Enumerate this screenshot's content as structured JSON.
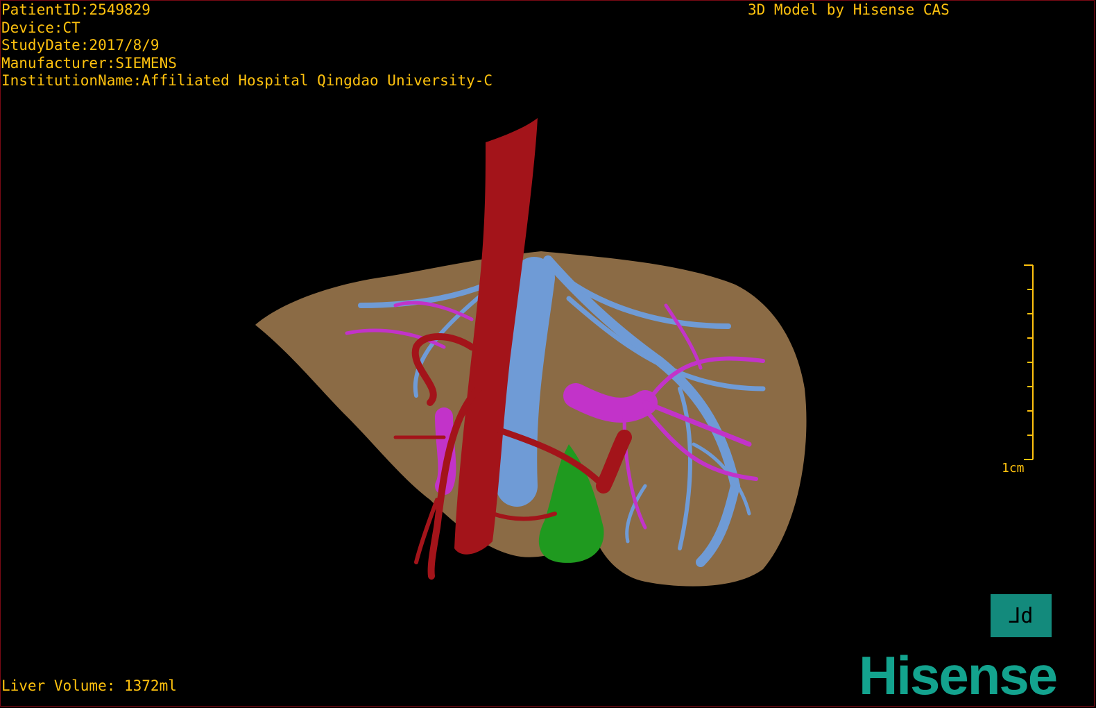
{
  "overlay": {
    "patient_id": "PatientID:2549829",
    "device": "Device:CT",
    "study_date": "StudyDate:2017/8/9",
    "manufacturer": "Manufacturer:SIEMENS",
    "institution": "InstitutionName:Affiliated Hospital Qingdao University-C",
    "credit": "3D Model by Hisense CAS",
    "liver_volume": "Liver Volume: 1372ml"
  },
  "scale_bar": {
    "label": "1cm"
  },
  "orientation": {
    "glyph": "⅃d"
  },
  "brand": {
    "logo": "Hisense"
  },
  "colors": {
    "text": "#ffc20e",
    "liver": "#8b6b45",
    "aorta": "#a3141a",
    "portal_vein": "#c233c9",
    "hepatic_vein": "#6f9bd6",
    "gallbladder": "#1f9a1f",
    "brand": "#13a38e"
  }
}
